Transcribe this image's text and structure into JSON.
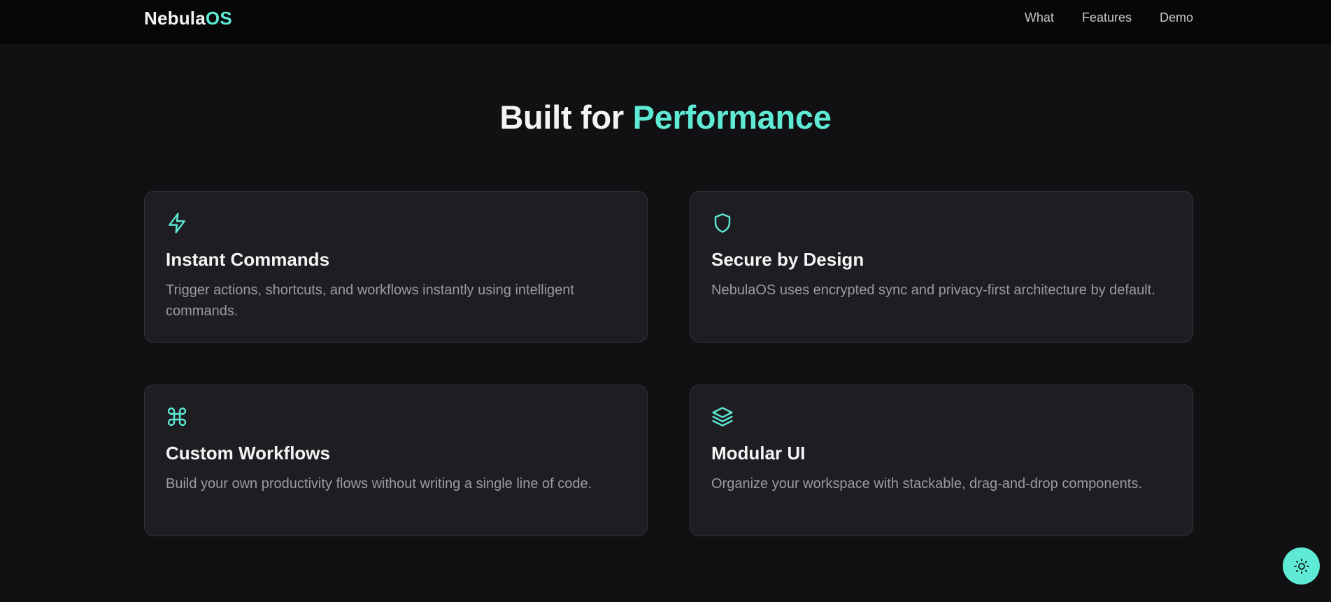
{
  "brand": {
    "name_part1": "Nebula",
    "name_part2": "OS"
  },
  "nav": {
    "items": [
      "What",
      "Features",
      "Demo"
    ]
  },
  "section": {
    "title_part1": "Built for ",
    "title_part2": "Performance"
  },
  "features": [
    {
      "icon": "lightning-icon",
      "title": "Instant Commands",
      "description": "Trigger actions, shortcuts, and workflows instantly using intelligent commands."
    },
    {
      "icon": "shield-icon",
      "title": "Secure by Design",
      "description": "NebulaOS uses encrypted sync and privacy-first architecture by default."
    },
    {
      "icon": "command-icon",
      "title": "Custom Workflows",
      "description": "Build your own productivity flows without writing a single line of code."
    },
    {
      "icon": "layers-icon",
      "title": "Modular UI",
      "description": "Organize your workspace with stackable, drag-and-drop components."
    }
  ],
  "theme_toggle": {
    "icon": "sun-icon"
  },
  "colors": {
    "accent": "#5eead4",
    "background": "#111113",
    "card": "#1e1e22",
    "header": "#070707"
  }
}
